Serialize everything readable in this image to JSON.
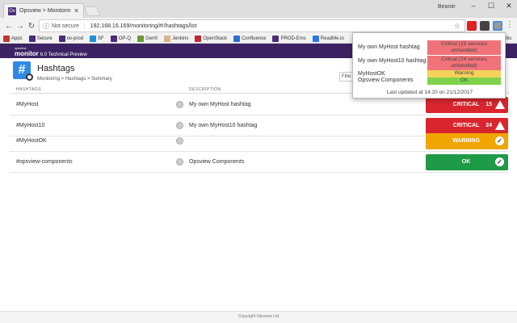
{
  "browser": {
    "tab_title": "Opsview > Monitoring",
    "user": "Beanie",
    "secure_label": "Not secure",
    "url": "192.168.16.169/monitoring/#!/hashtags/list",
    "bookmarks": [
      "Apps",
      "Secure",
      "ov-prod",
      "SF",
      "OP-Q",
      "Gerrit",
      "Jenkins",
      "OpenStack",
      "Confluence",
      "PROD-Ems",
      "ReadMe.io"
    ],
    "bookmarks_tail": "arks"
  },
  "app": {
    "brand_small": "opsview",
    "brand_big": "monitor",
    "brand_version": "6.0 Technical Preview"
  },
  "page": {
    "title": "Hashtags",
    "breadcrumb": "Monitoring > Hashtags > Summary",
    "filter_placeholder": "Filte"
  },
  "table": {
    "col_hashtags": "HASHTAGS",
    "col_description": "DESCRIPTION",
    "rows": [
      {
        "name": "#MyHost",
        "description": "My own MyHost hashtag",
        "status": "CRITICAL",
        "count": "15"
      },
      {
        "name": "#MyHost10",
        "description": "My own MyHost10 hashtag",
        "status": "CRITICAL",
        "count": "24"
      },
      {
        "name": "#MyHostOK",
        "description": "",
        "status": "WARNING",
        "count": ""
      },
      {
        "name": "#opsview-components",
        "description": "Opsview Components",
        "status": "OK",
        "count": ""
      }
    ]
  },
  "footer": "Copyright Opsview Ltd",
  "popup": {
    "rows": [
      {
        "name": "My own MyHost hashtag",
        "status": "Critical (15 services unhandled)"
      },
      {
        "name": "My own MyHost10 hashtag",
        "status": "Critical (24 services unhandled)"
      },
      {
        "name": "MyHostOK",
        "status": "Warning"
      },
      {
        "name": "Opsview Components",
        "status": "OK"
      }
    ],
    "updated": "Last updated at 14:20 on 21/12/2017"
  },
  "colors": {
    "header": "#3d2363",
    "critical": "#d9262e",
    "warning": "#f0a500",
    "ok": "#1f9a47"
  }
}
